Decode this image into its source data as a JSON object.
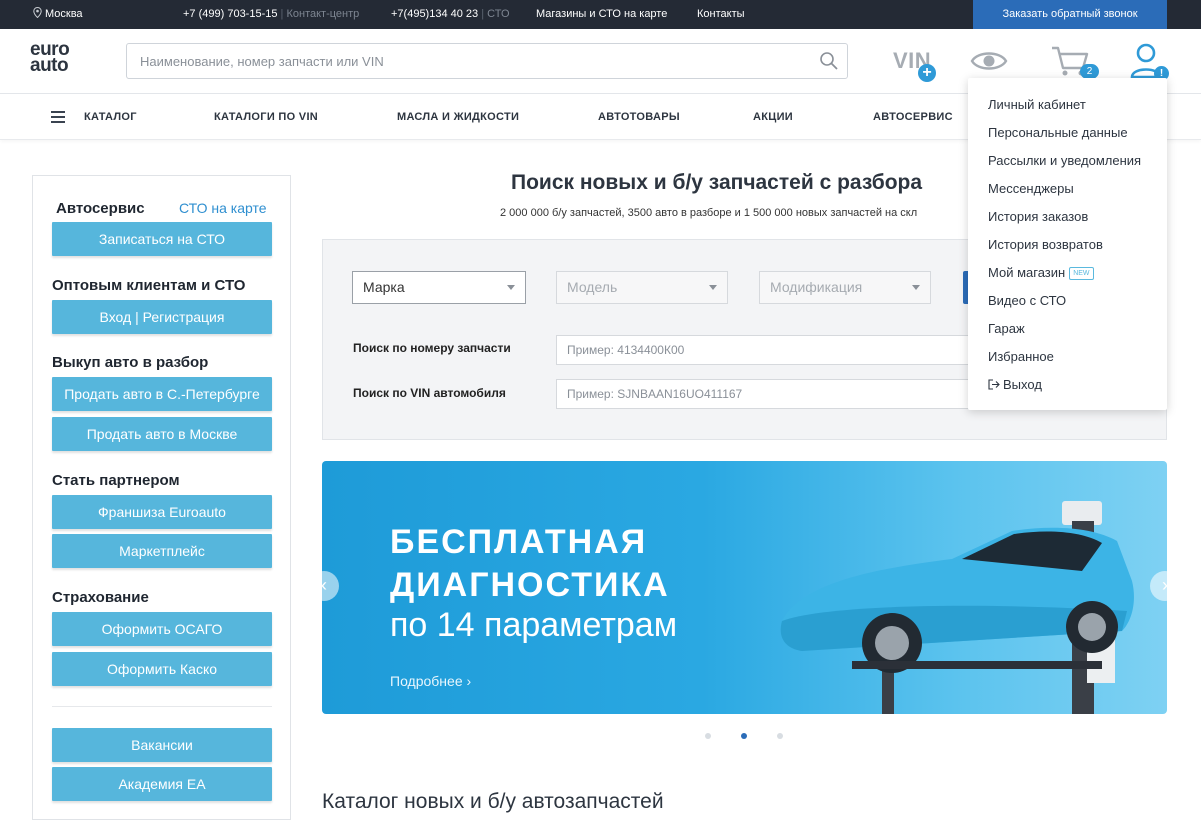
{
  "topbar": {
    "city": "Москва",
    "phone1": "+7 (499) 703-15-15",
    "phone1_note": "Контакт-центр",
    "phone2": "+7(495)134 40 23",
    "phone2_note": "СТО",
    "stores_link": "Магазины и СТО на карте",
    "contacts_link": "Контакты",
    "callback_button": "Заказать обратный звонок"
  },
  "header": {
    "logo_line1": "euro",
    "logo_line2": "auto",
    "search_placeholder": "Наименование, номер запчасти или VIN",
    "vin_label": "VIN",
    "vin_plus": "+",
    "cart_count": "2",
    "user_badge": "!"
  },
  "nav": {
    "items": [
      "КАТАЛОГ",
      "КАТАЛОГИ ПО VIN",
      "МАСЛА И ЖИДКОСТИ",
      "АВТОТОВАРЫ",
      "АКЦИИ",
      "АВТОСЕРВИС"
    ]
  },
  "sidebar": {
    "autoservice_title": "Автосервис",
    "sto_map_link": "СТО на карте",
    "sto_button": "Записаться на СТО",
    "wholesale_title": "Оптовым клиентам и СТО",
    "login_button": "Вход | Регистрация",
    "buyout_title": "Выкуп авто в разбор",
    "sell_spb_button": "Продать авто в С.-Петербурге",
    "sell_msk_button": "Продать авто в Москве",
    "partner_title": "Стать партнером",
    "franchise_button": "Франшиза Euroauto",
    "marketplace_button": "Маркетплейс",
    "insurance_title": "Страхование",
    "osago_button": "Оформить ОСАГО",
    "kasko_button": "Оформить Каско",
    "vacancies_button": "Вакансии",
    "academy_button": "Академия ЕА"
  },
  "main": {
    "title": "Поиск новых и б/у запчастей с разбора",
    "subtitle": "2 000 000 б/у запчастей, 3500 авто в разборе и 1 500 000 новых запчастей на скл",
    "brand_select": "Марка",
    "model_select": "Модель",
    "modification_select": "Модификация",
    "part_number_label": "Поиск по номеру запчасти",
    "part_number_placeholder": "Пример: 4134400К00",
    "vin_search_label": "Поиск по VIN автомобиля",
    "vin_search_placeholder": "Пример: SJNBAAN16UO411167",
    "catalog_title": "Каталог новых и б/у автозапчастей"
  },
  "banner": {
    "line1": "БЕСПЛАТНАЯ",
    "line2": "ДИАГНОСТИКА",
    "line3": "по 14 параметрам",
    "more_link": "Подробнее",
    "slide_count": 3,
    "active_slide": 2
  },
  "user_menu": {
    "items": [
      "Личный кабинет",
      "Персональные данные",
      "Рассылки и уведомления",
      "Мессенджеры",
      "История заказов",
      "История возвратов",
      "Мой магазин",
      "Видео с СТО",
      "Гараж",
      "Избранное",
      "Выход"
    ],
    "new_badge": "NEW"
  },
  "colors": {
    "topbar_bg": "#242a35",
    "accent_blue": "#2b6cb8",
    "sidebar_button": "#56b6dc",
    "link_blue": "#2f8fd0"
  }
}
